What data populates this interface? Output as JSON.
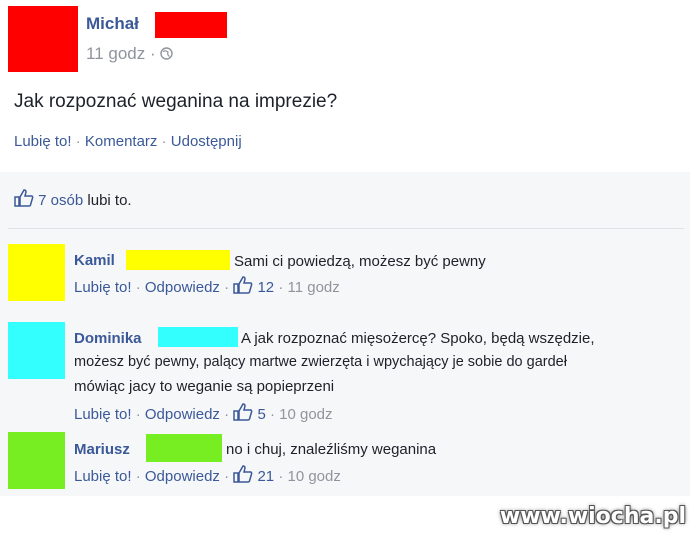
{
  "post": {
    "author": "Michał",
    "time": "11 godz",
    "globe_icon": "globe-icon",
    "text": "Jak rozpoznać weganina na imprezie?",
    "actions": {
      "like": "Lubię to!",
      "comment": "Komentarz",
      "share": "Udostępnij"
    },
    "likes_summary": {
      "count_text": "7 osób",
      "suffix": "lubi to."
    }
  },
  "comments": [
    {
      "author": "Kamil",
      "text": "Sami ci powiedzą, możesz być pewny",
      "like": "Lubię to!",
      "reply": "Odpowiedz",
      "likes": "12",
      "time": "11 godz",
      "avatar_color": "#ffff00",
      "redact_color": "#ffff00"
    },
    {
      "author": "Dominika",
      "text_line1": "A jak rozpoznać mięsożercę? Spoko, będą wszędzie,",
      "text_line2": "możesz być pewny, palący martwe zwierzęta i wpychający je sobie do gardeł",
      "text_line3": "mówiąc jacy to weganie są popieprzeni",
      "like": "Lubię to!",
      "reply": "Odpowiedz",
      "likes": "5",
      "time": "10 godz",
      "avatar_color": "#33ffff",
      "redact_color": "#33ffff"
    },
    {
      "author": "Mariusz",
      "text": "no i chuj, znaleźliśmy weganina",
      "like": "Lubię to!",
      "reply": "Odpowiedz",
      "likes": "21",
      "time": "10 godz",
      "avatar_color": "#77ee22",
      "redact_color": "#77ee22"
    }
  ],
  "colors": {
    "link": "#3b5998",
    "muted": "#90949c",
    "panel": "#f6f7f9",
    "redact_red": "#ff0000"
  },
  "watermark": "www.wiocha.pl"
}
